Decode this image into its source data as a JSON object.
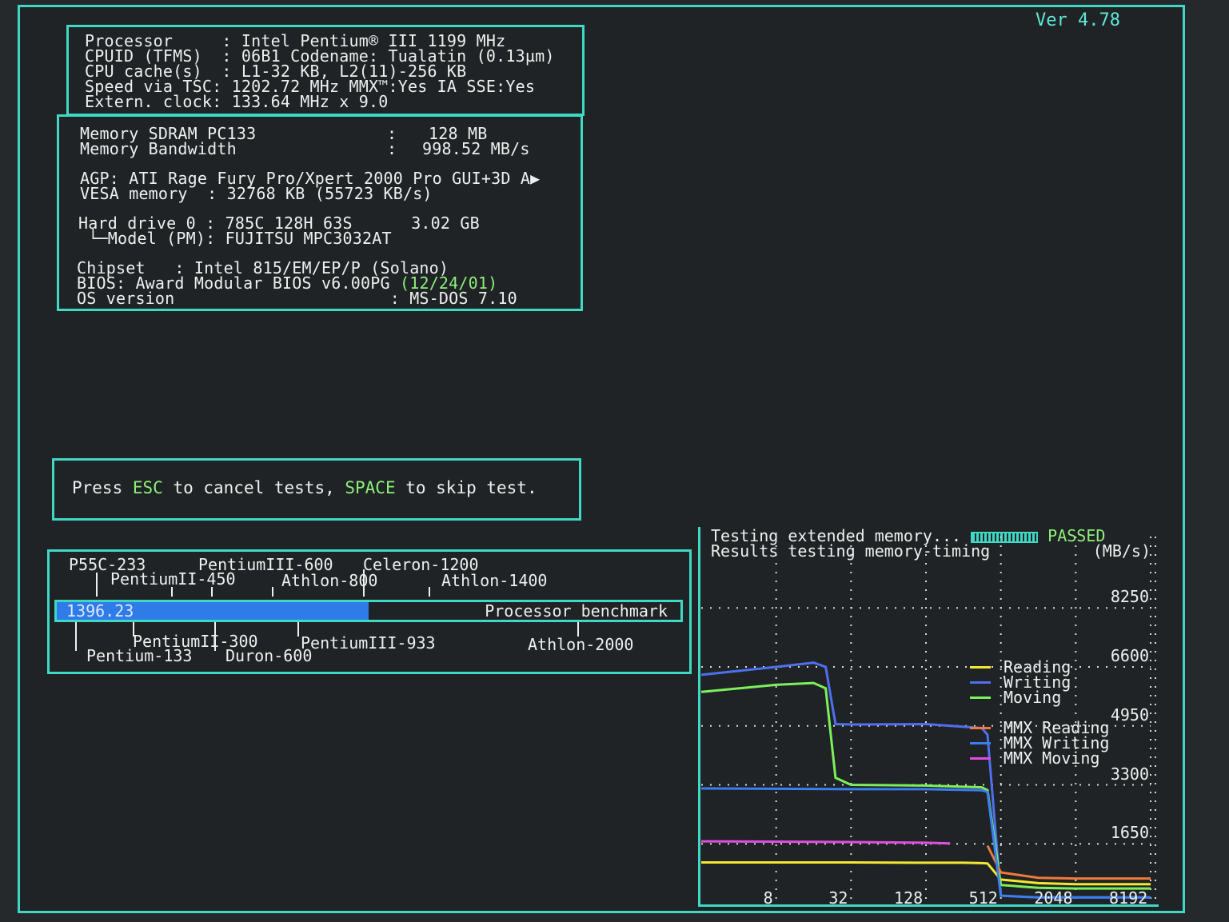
{
  "version": "Ver 4.78",
  "sysinfo": {
    "proc_label": "Processor     :",
    "proc_value": "Intel Pentium® III 1199 MHz",
    "cpuid_label": "CPUID (TFMS)  :",
    "cpuid_value": "06B1 Codename: Tualatin (0.13µm)",
    "cache_label": "CPU cache(s)  :",
    "cache_value": "L1-32 KB, L2(11)-256 KB",
    "tsc_label": "Speed via TSC:",
    "tsc_value": "1202.72 MHz MMX™:Yes IA SSE:Yes",
    "ext_label": "Extern. clock:",
    "ext_value": "133.64 MHz x 9.0",
    "mem_label": "Memory SDRAM PC133",
    "mem_sep": ":",
    "mem_value": "128 MB",
    "bw_label": "Memory Bandwidth",
    "bw_sep": ":",
    "bw_value": "998.52 MB/s",
    "agp_text": "AGP: ATI Rage Fury Pro/Xpert 2000 Pro GUI+3D A▶",
    "vesa_text": "VESA memory  : 32768 KB (55723 KB/s)",
    "hdd_text": "Hard drive 0 : 785C 128H 63S      3.02 GB",
    "model_text": " └─Model (PM): FUJITSU MPC3032AT",
    "chipset_text": "Chipset   : Intel 815/EM/EP/P (Solano)",
    "bios_text": "BIOS: Award Modular BIOS v6.00PG",
    "bios_date": "(12/24/01)",
    "os_text": "OS version                      : MS-DOS 7.10"
  },
  "hint": {
    "press": "Press ",
    "esc": "ESC",
    "cancel": " to cancel tests, ",
    "space": "SPACE",
    "skip": " to skip test."
  },
  "benchmark": {
    "score": "1396.23",
    "score_fraction": 0.5,
    "title": "Processor benchmark",
    "top_refs": [
      "P55C-233",
      "PentiumII-450",
      "PentiumIII-600",
      "Athlon-800",
      "Celeron-1200",
      "Athlon-1400"
    ],
    "bottom_refs": [
      "PentiumII-300",
      "PentiumIII-933",
      "Athlon-2000",
      "Pentium-133",
      "Duron-600"
    ]
  },
  "graph": {
    "line1": "Testing extended memory... ",
    "passed": "PASSED",
    "line2": "Results testing memory-timing",
    "unit": "(MB/s)",
    "y_ticks": [
      "8250",
      "6600",
      "4950",
      "3300",
      "1650"
    ],
    "x_ticks": [
      "8",
      "32",
      "128",
      "512",
      "2048",
      "8192"
    ],
    "legend": [
      {
        "label": "Reading",
        "color": "#f2e832"
      },
      {
        "label": "Writing",
        "color": "#4f6ff0"
      },
      {
        "label": "Moving",
        "color": "#7cf05a"
      },
      {
        "label": "MMX Reading",
        "color": "#f07a3a"
      },
      {
        "label": "MMX Writing",
        "color": "#3a7ef0"
      },
      {
        "label": "MMX Moving",
        "color": "#e04ee0"
      }
    ]
  },
  "chart_data": {
    "type": "line",
    "title": "Results testing memory-timing",
    "ylabel": "(MB/s)",
    "xlabel": "",
    "x": [
      8,
      32,
      128,
      512,
      2048,
      8192
    ],
    "x_scale": "log",
    "ylim": [
      0,
      8250
    ],
    "grid": true,
    "legend_position": "right",
    "series": [
      {
        "name": "Reading",
        "color": "#f2e832",
        "x": [
          2,
          8,
          32,
          128,
          256,
          360,
          400,
          512,
          1024,
          2048,
          8192
        ],
        "values": [
          1130,
          1130,
          1130,
          1120,
          1120,
          1110,
          1100,
          650,
          550,
          520,
          520
        ]
      },
      {
        "name": "Writing",
        "color": "#4f6ff0",
        "x": [
          2,
          8,
          16,
          20,
          24,
          32,
          128,
          360,
          400,
          512,
          1024,
          2048,
          8192
        ],
        "values": [
          6380,
          6600,
          6720,
          6600,
          5000,
          4990,
          5000,
          4890,
          4700,
          200,
          150,
          150,
          150
        ]
      },
      {
        "name": "Moving",
        "color": "#7cf05a",
        "x": [
          2,
          8,
          16,
          20,
          24,
          32,
          128,
          360,
          400,
          512,
          1024,
          2048,
          8192
        ],
        "values": [
          5900,
          6100,
          6150,
          6000,
          3500,
          3300,
          3280,
          3230,
          3150,
          500,
          420,
          400,
          400
        ]
      },
      {
        "name": "MMX Reading",
        "color": "#f07a3a",
        "x": [
          400,
          512,
          1024,
          2048,
          8192
        ],
        "values": [
          1600,
          850,
          700,
          680,
          680
        ]
      },
      {
        "name": "MMX Writing",
        "color": "#3a7ef0",
        "x": [
          2,
          32,
          128,
          360,
          400,
          512,
          1024,
          2048,
          8192
        ],
        "values": [
          3200,
          3180,
          3180,
          3150,
          3100,
          200,
          150,
          150,
          150
        ]
      },
      {
        "name": "MMX Moving",
        "color": "#e04ee0",
        "x": [
          2,
          32,
          128,
          200
        ],
        "values": [
          1720,
          1700,
          1680,
          1660
        ]
      }
    ]
  }
}
